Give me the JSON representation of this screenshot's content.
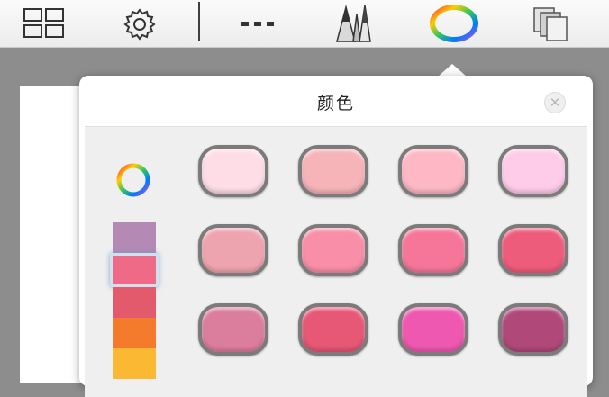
{
  "toolbar": {
    "items": [
      {
        "name": "grid-view-icon"
      },
      {
        "name": "gear-icon"
      },
      {
        "name": "more-icon"
      },
      {
        "name": "brushes-icon"
      },
      {
        "name": "color-wheel-icon"
      },
      {
        "name": "layers-icon"
      }
    ]
  },
  "popover": {
    "title": "颜色",
    "close_label": "✕"
  },
  "sidebar": {
    "wheel_icon": "color-wheel-icon",
    "strip_colors": [
      "#b48ab4",
      "#ee6a86",
      "#e35a6c",
      "#f47a2c",
      "#fbb832"
    ],
    "selected_index": 1
  },
  "swatches": [
    [
      "#ffdde7",
      "#f6b3b8",
      "#fdb7c5",
      "#fecbe8"
    ],
    [
      "#eea4ae",
      "#f88ea8",
      "#f6769a",
      "#ee5c7c"
    ],
    [
      "#db7e9d",
      "#e75776",
      "#ef58b0",
      "#b0497a"
    ]
  ]
}
